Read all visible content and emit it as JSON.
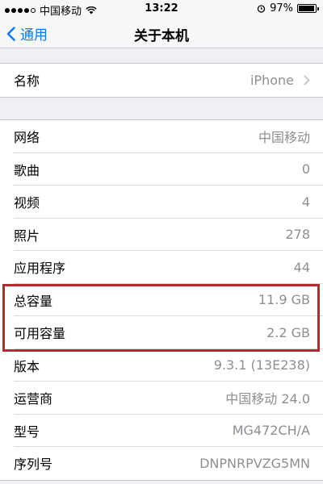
{
  "status_bar": {
    "carrier": "中国移动",
    "time": "13:22",
    "battery": "97%",
    "battery_level": 0.97
  },
  "nav": {
    "back_label": "通用",
    "title": "关于本机"
  },
  "name_row": {
    "label": "名称",
    "value": "iPhone"
  },
  "rows": [
    {
      "label": "网络",
      "value": "中国移动"
    },
    {
      "label": "歌曲",
      "value": "0"
    },
    {
      "label": "视频",
      "value": "4"
    },
    {
      "label": "照片",
      "value": "278"
    },
    {
      "label": "应用程序",
      "value": "44"
    },
    {
      "label": "总容量",
      "value": "11.9 GB"
    },
    {
      "label": "可用容量",
      "value": "2.2 GB"
    },
    {
      "label": "版本",
      "value": "9.3.1 (13E238)"
    },
    {
      "label": "运营商",
      "value": "中国移动 24.0"
    },
    {
      "label": "型号",
      "value": "MG472CH/A"
    },
    {
      "label": "序列号",
      "value": "DNPNRPVZG5MN"
    }
  ],
  "colors": {
    "accent": "#007aff",
    "highlight": "#b8282e",
    "background": "#efeff4"
  }
}
